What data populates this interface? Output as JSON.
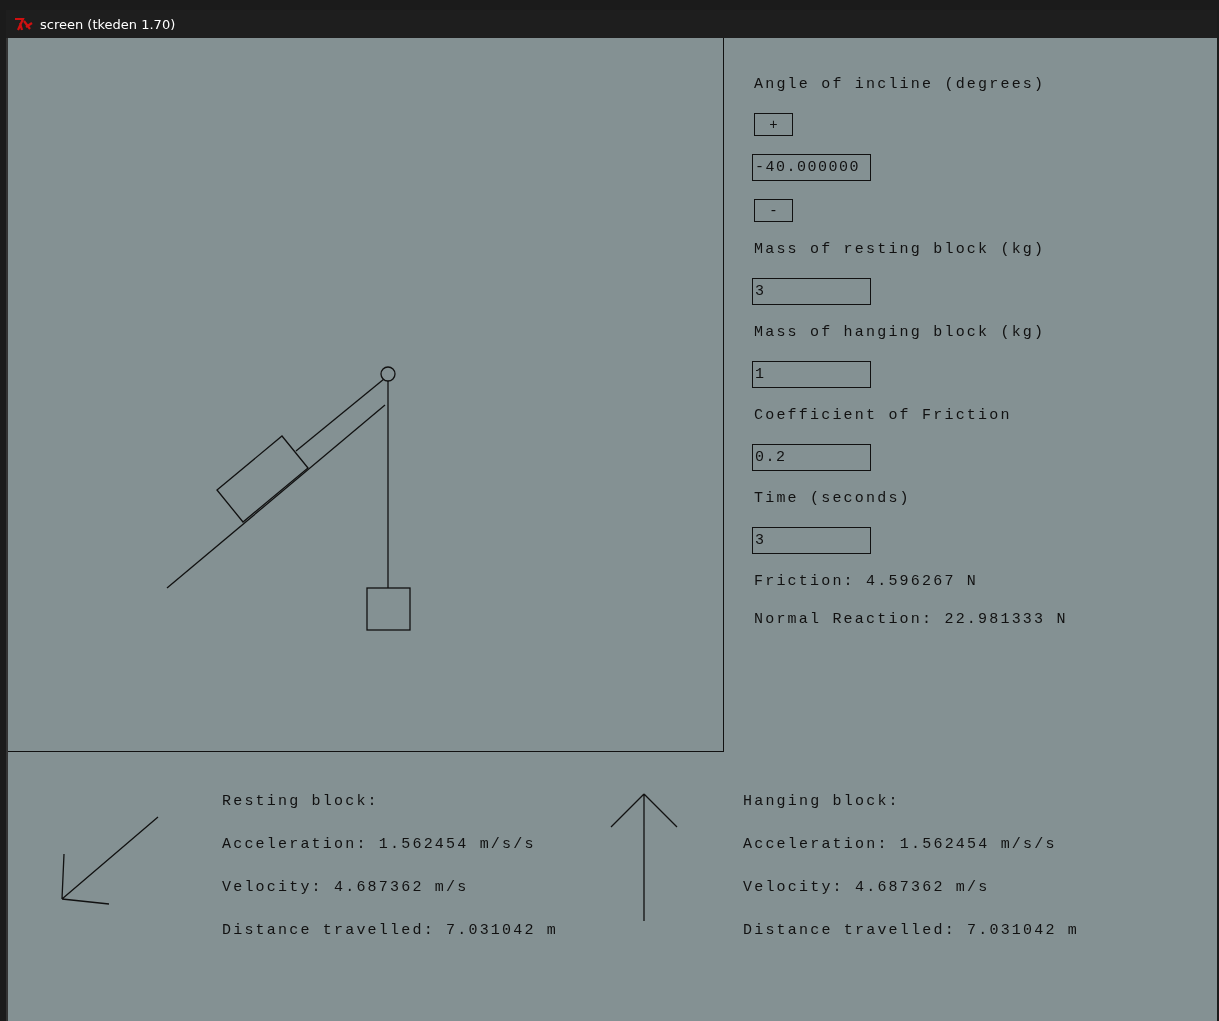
{
  "window": {
    "title": "screen (tkeden 1.70)"
  },
  "controls": [
    {
      "kind": "label",
      "text": "Angle of incline (degrees)"
    },
    {
      "kind": "button",
      "text": "+"
    },
    {
      "kind": "field",
      "value": "-40.000000"
    },
    {
      "kind": "button",
      "text": "-"
    },
    {
      "kind": "label",
      "text": "Mass of resting block (kg)"
    },
    {
      "kind": "field",
      "value": "3"
    },
    {
      "kind": "label",
      "text": "Mass of hanging block (kg)"
    },
    {
      "kind": "field",
      "value": "1"
    },
    {
      "kind": "label",
      "text": "Coefficient of Friction"
    },
    {
      "kind": "field",
      "value": "0.2"
    },
    {
      "kind": "label",
      "text": "Time (seconds)"
    },
    {
      "kind": "field",
      "value": "3"
    },
    {
      "kind": "label",
      "text": "Friction: 4.596267 N"
    },
    {
      "kind": "label",
      "text": "Normal Reaction: 22.981333 N"
    }
  ],
  "resting_block": {
    "title": "Resting block:",
    "lines": [
      "Acceleration: 1.562454 m/s/s",
      "Velocity: 4.687362 m/s",
      "Distance travelled: 7.031042 m"
    ]
  },
  "hanging_block": {
    "title": "Hanging block:",
    "lines": [
      "Acceleration: 1.562454 m/s/s",
      "Velocity: 4.687362 m/s",
      "Distance travelled: 7.031042 m"
    ]
  }
}
